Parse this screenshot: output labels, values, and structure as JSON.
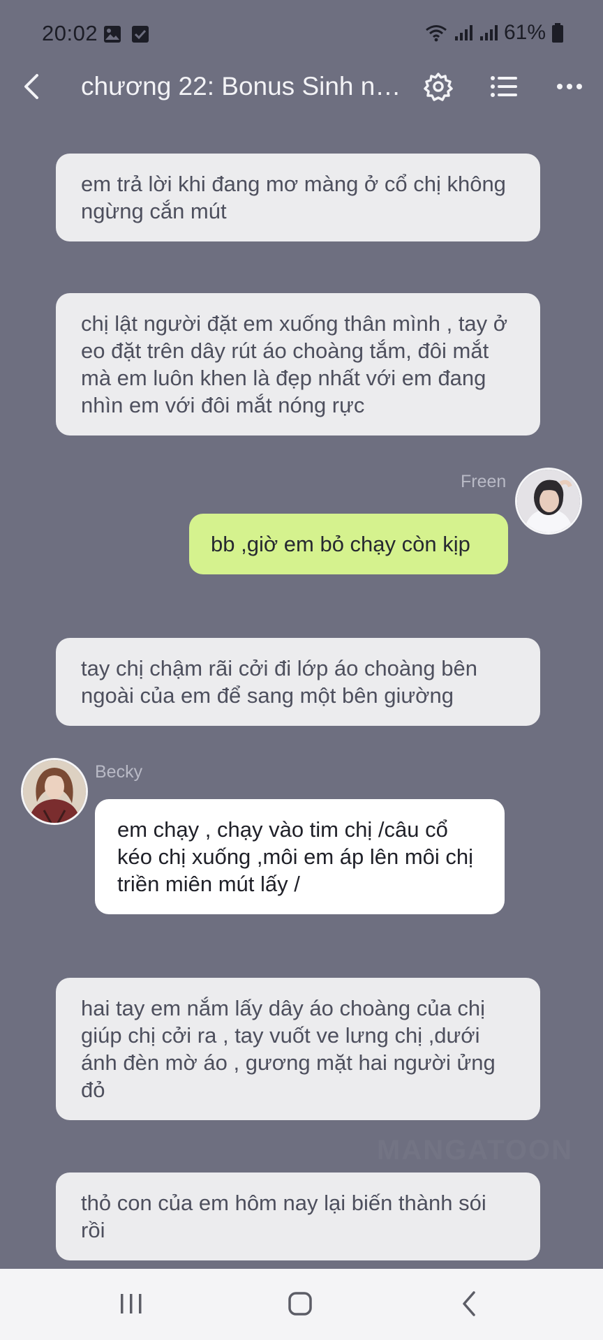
{
  "status_bar": {
    "time": "20:02",
    "battery": "61%",
    "icons": [
      "image-icon",
      "checkbox-icon",
      "wifi-icon",
      "signal-icon",
      "signal-icon",
      "battery-icon"
    ]
  },
  "toolbar": {
    "title": "chương 22: Bonus Sinh nh...",
    "icons": [
      "back-icon",
      "gear-icon",
      "list-icon",
      "more-icon"
    ]
  },
  "messages": [
    {
      "type": "narration",
      "text": "em trả lời khi đang mơ màng ở cổ chị không ngừng cắn mút"
    },
    {
      "type": "narration",
      "text": "chị lật người đặt em xuống thân mình , tay ở eo đặt trên dây rút áo choàng tắm, đôi mắt mà em luôn khen là đẹp nhất với em đang nhìn em với đôi mắt nóng rực"
    },
    {
      "type": "user",
      "sender": "Freen",
      "text": "bb ,giờ em bỏ chạy còn kịp"
    },
    {
      "type": "narration",
      "text": "tay chị chậm rãi cởi đi lớp áo choàng bên ngoài của em để sang một bên giường"
    },
    {
      "type": "other",
      "sender": "Becky",
      "text": "em chạy , chạy vào tim chị /câu cổ kéo chị xuống ,môi em áp lên môi chị triền miên mút lấy /"
    },
    {
      "type": "narration",
      "text": "hai tay em nắm lấy dây áo choàng của chị giúp chị cởi ra , tay vuốt ve lưng chị ,dưới ánh đèn mờ áo , gương mặt hai người ửng đỏ"
    },
    {
      "type": "narration",
      "text": "thỏ con của em hôm nay lại biến thành sói rồi"
    }
  ],
  "watermark": "MANGATOON",
  "nav_bar": {
    "icons": [
      "recents-icon",
      "home-icon",
      "back-icon"
    ]
  },
  "colors": {
    "background": "#6e6f80",
    "narration_bubble": "#ececee",
    "user_bubble": "#d5f28e",
    "other_bubble": "#ffffff",
    "nav_bar": "#f4f4f6"
  }
}
